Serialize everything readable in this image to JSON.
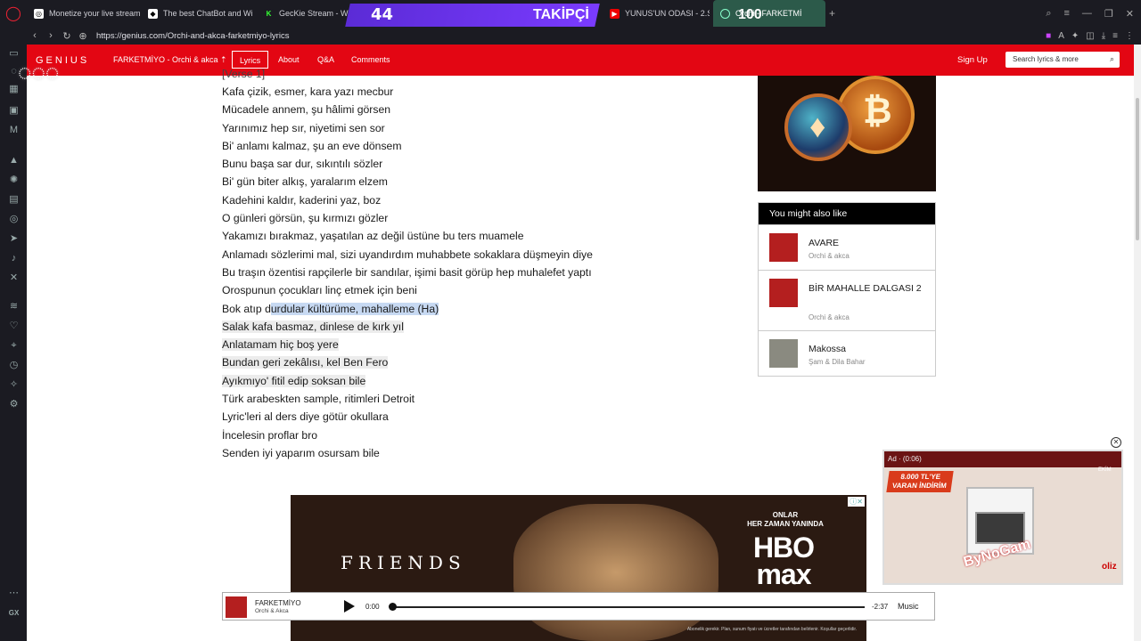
{
  "browser": {
    "tabs": [
      {
        "title": "Monetize your live stream"
      },
      {
        "title": "The best ChatBot and Wi"
      },
      {
        "title": "GecKie Stream - Watch"
      },
      {
        "title": "YUNUS'UN ODASI - 2.SE"
      },
      {
        "title": "Orchi - FARKETMİ"
      }
    ],
    "url": "https://genius.com/Orchi-and-akca-farketmiyo-lyrics",
    "new_tab": "+"
  },
  "stream_overlay": {
    "count_left": "44",
    "label": "TAKİPÇİ",
    "count_right": "100"
  },
  "genius": {
    "logo": "GENIUS",
    "song_heading": "FARKETMİYO - Orchi & akca ⇡",
    "nav": [
      "Lyrics",
      "About",
      "Q&A",
      "Comments"
    ],
    "sign_up": "Sign Up",
    "search_placeholder": "Search lyrics & more"
  },
  "lyrics": {
    "section_tag": "[Verse 1]",
    "lines": [
      "Kafa çizik, esmer, kara yazı mecbur",
      "Mücadele annem, şu hâlimi görsen",
      "Yarınımız hep sır, niyetimi sen sor",
      "Bi' anlamı kalmaz, şu an eve dönsem",
      "Bunu başa sar dur, sıkıntılı sözler",
      "Bi' gün biter alkış, yaralarım elzem",
      "Kadehini kaldır, kaderini yaz, boz",
      "O günleri görsün, şu kırmızı gözler",
      "Yakamızı bırakmaz, yaşatılan az değil üstüne bu ters muamele",
      "Anlamadı sözlerimi mal, sizi uyandırdım muhabbete sokaklara düşmeyin diye",
      "Bu traşın özentisi rapçilerle bir sandılar, işimi basit görüp hep muhalefet yaptı",
      "Orospunun çocukları linç etmek için beni"
    ],
    "line_selected_pre": "Bok atıp d",
    "line_selected_hl": "urdular kültürüme, mahalleme (Ha)",
    "lines_grey": [
      "Salak kafa basmaz, dinlese de kırk yıl",
      "Anlatamam hiç boş yere",
      "Bundan geri zekâlısı, kel Ben Fero",
      "Ayıkmıyo' fitil edip soksan bile"
    ],
    "lines_after": [
      "Türk arabeskten sample, ritimleri Detroit",
      "Lyric'leri al ders diye götür okullara",
      "İncelesin proflar bro",
      "Senden iyi yaparım osursam bile"
    ]
  },
  "sidebar_module": {
    "heading": "You might also like",
    "items": [
      {
        "title": "AVARE",
        "artist": "Orchi & akca"
      },
      {
        "title": "BİR MAHALLE DALGASI 2",
        "artist": "Orchi & akca"
      },
      {
        "title": "Makossa",
        "artist": "Şam & Dila Bahar"
      }
    ]
  },
  "ad_banner": {
    "show": "FRIENDS",
    "tagline_1": "ONLAR",
    "tagline_2": "HER ZAMAN YANINDA",
    "brand_1": "HBO",
    "brand_2": "max",
    "fine_print": "Abonelik gerekir. Plan, sunum fiyatı ve ücretler tarafından belirlenir. Koşullar geçerlidir."
  },
  "player": {
    "title": "FARKETMİYO",
    "artist": "Orchi & Akca",
    "time_current": "0:00",
    "time_remaining": "-2:37",
    "service": "Music",
    "progress": 0
  },
  "video_ad": {
    "label": "Ad · (0:06)",
    "badge": "8.000 TL'YE VARAN İNDİRİM",
    "month": "EKİM",
    "watermark": "ByNoGam",
    "logo": "oliz"
  },
  "colors": {
    "genius_red": "#e30613",
    "selection": "#c7d9f2"
  }
}
